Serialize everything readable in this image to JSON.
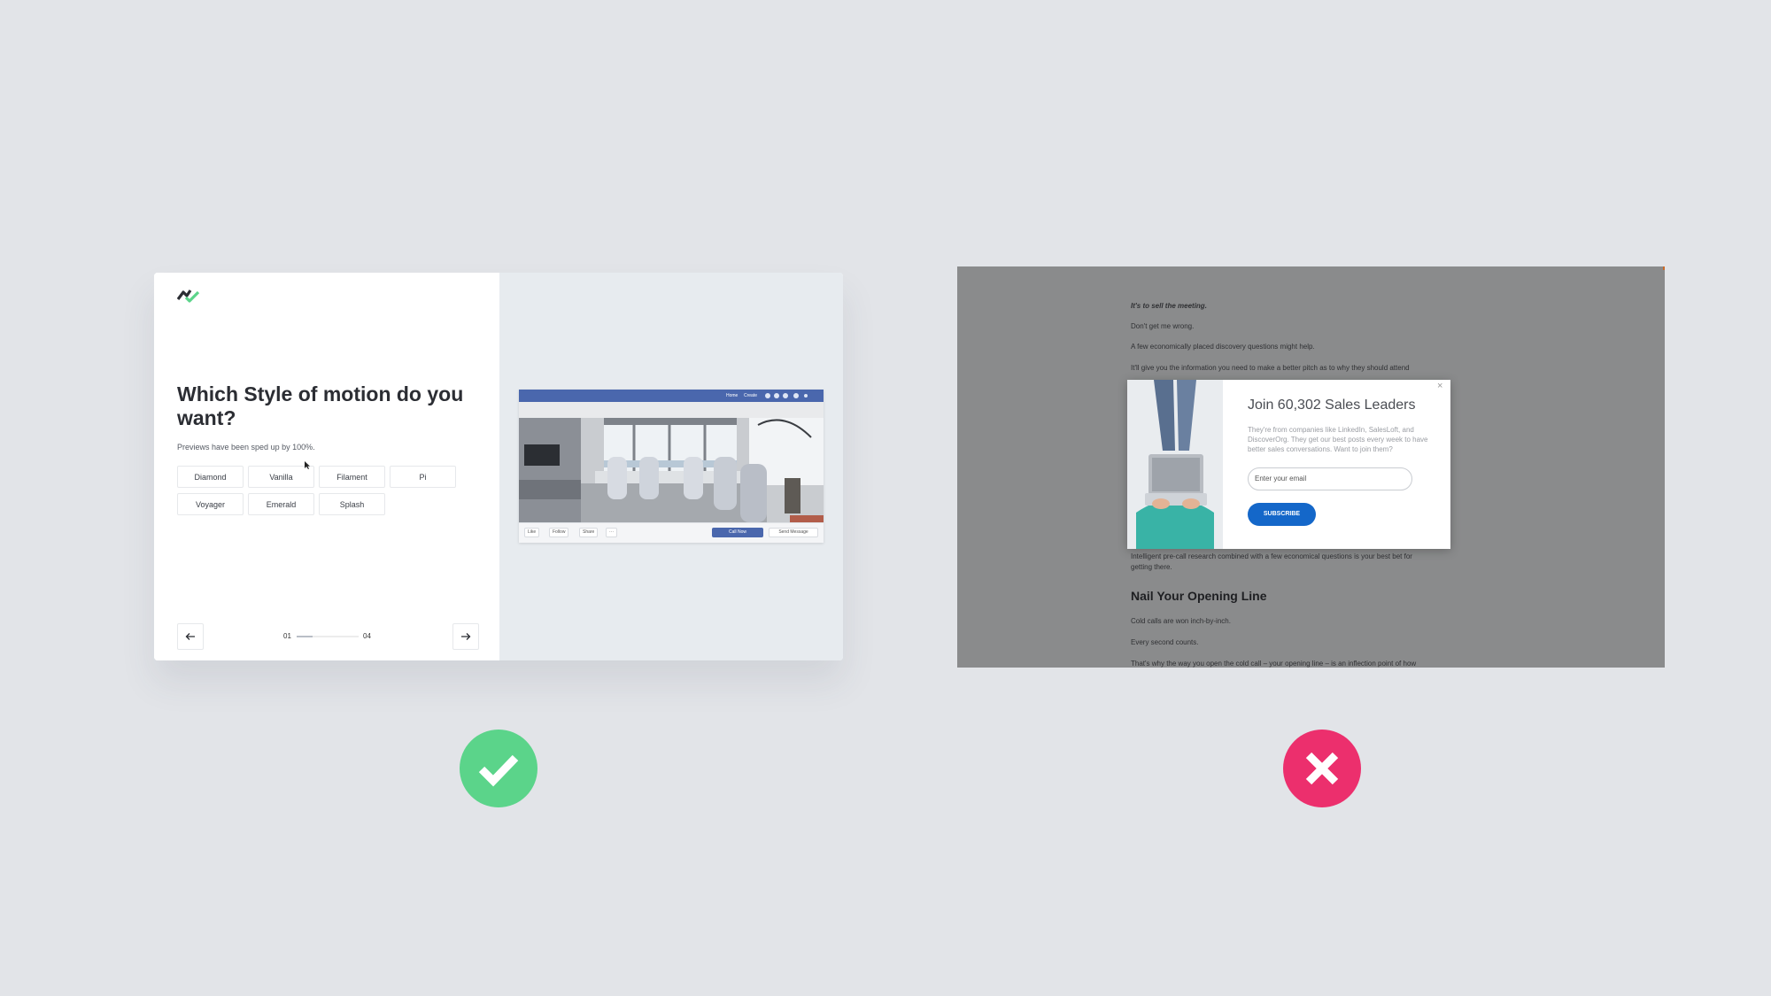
{
  "good_example": {
    "question": "Which Style of motion do you want?",
    "subtitle": "Previews have been sped up by 100%.",
    "styles": [
      "Diamond",
      "Vanilla",
      "Filament",
      "Pi",
      "Voyager",
      "Emerald",
      "Splash"
    ],
    "progress": {
      "current": "01",
      "total": "04",
      "fraction": 0.25
    },
    "prev_label": "←",
    "next_label": "→",
    "preview": {
      "nav_links": [
        "Home",
        "Create"
      ],
      "actions": [
        "Like",
        "Follow",
        "Share",
        "···"
      ],
      "call_button": "Call Now",
      "message_button": "Send Message"
    }
  },
  "bad_example": {
    "article_lines_top": [
      "It's to sell the meeting.",
      "Don't get me wrong.",
      "A few economically placed discovery questions might help.",
      "It'll give you the information you need to make a better pitch as to why they should attend"
    ],
    "article_lines_bottom": [
      "Intelligent pre-call research combined with a few economical questions is your best bet for",
      "getting there."
    ],
    "heading": "Nail Your Opening Line",
    "article_lines_after": [
      "Cold calls are won inch-by-inch.",
      "Every second counts.",
      "That's why the way you open the cold call – your opening line – is an inflection point of how"
    ],
    "popup": {
      "title": "Join 60,302 Sales Leaders",
      "body": "They're from companies like LinkedIn, SalesLoft, and DiscoverOrg. They get our best posts every week to have better sales conversations. Want to join them?",
      "email_placeholder": "Enter your email",
      "subscribe_label": "SUBSCRIBE",
      "close_label": "×"
    }
  },
  "colors": {
    "good": "#5bd48a",
    "bad": "#ec2f6d",
    "subscribe": "#1467c9",
    "fb_blue": "#4a67ad"
  },
  "icons": [
    "logo-icon",
    "arrow-left-icon",
    "arrow-right-icon",
    "cursor-icon",
    "check-icon",
    "cross-icon",
    "close-icon"
  ]
}
